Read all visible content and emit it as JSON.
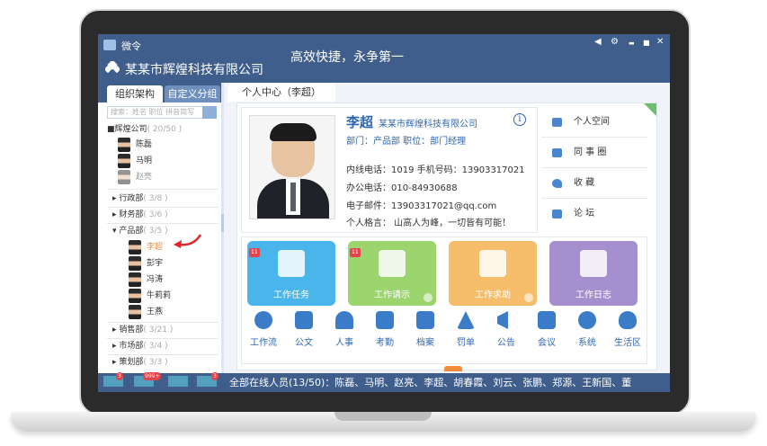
{
  "window": {
    "app_name": "微令",
    "company_name": "某某市辉煌科技有限公司",
    "slogan": "高效快捷，永争第一",
    "controls": [
      "◀",
      "⚙",
      "▬",
      "■",
      "✕"
    ]
  },
  "left_panel": {
    "tabs": [
      "组织架构",
      "自定义分组"
    ],
    "search_placeholder": "搜索：姓名 职位 拼音简写",
    "root": {
      "label": "■辉煌公司",
      "count": "( 20/50 )"
    },
    "root_people": [
      "陈磊",
      "马明",
      "赵亮"
    ],
    "departments": [
      {
        "label": "行政部",
        "count": "( 3/8 )"
      },
      {
        "label": "财务部",
        "count": "( 3/6 )"
      },
      {
        "label": "产品部",
        "count": "( 3/5 )"
      },
      {
        "label": "销售部",
        "count": "( 3/21 )"
      },
      {
        "label": "市场部",
        "count": "( 3/4 )"
      },
      {
        "label": "策划部",
        "count": "( 3/3 )"
      }
    ],
    "product_people": [
      "李超",
      "彭宇",
      "冯涛",
      "牛莉莉",
      "王燕"
    ]
  },
  "main": {
    "tab_label": "个人中心（李超）",
    "profile": {
      "name": "李超",
      "company": "某某市辉煌科技有限公司",
      "dept_line": "部门：产品部    职位：部门经理",
      "phones": "内线电话：1019   手机号码：13903317021",
      "office_phone": "办公电话：010-84930688",
      "email": "电子邮件：13903317021@qq.com",
      "motto": "个人格言：  山高人为峰，一切皆有可能！",
      "info_icon": "i"
    },
    "links": [
      "个人空间",
      "同 事 圈",
      "收     藏",
      "论     坛"
    ],
    "tiles": [
      {
        "label": "工作任务",
        "badge": "11",
        "color": "#4ab5ea"
      },
      {
        "label": "工作请示",
        "badge": "11",
        "color": "#9cd46e"
      },
      {
        "label": "工作求助",
        "badge": "",
        "color": "#f6bd6a"
      },
      {
        "label": "工作日志",
        "badge": "",
        "color": "#a58fcf"
      }
    ],
    "tools": [
      "工作流",
      "公文",
      "人事",
      "考勤",
      "档案",
      "罚单",
      "公告",
      "会议",
      "系统",
      "生活区"
    ]
  },
  "bottom": {
    "badges": [
      "3",
      "999+",
      "3"
    ],
    "online": "全部在线人员(13/50)：陈磊、马明、赵亮、李超、胡春霞、刘云、张鹏、郑源、王新国、董"
  }
}
